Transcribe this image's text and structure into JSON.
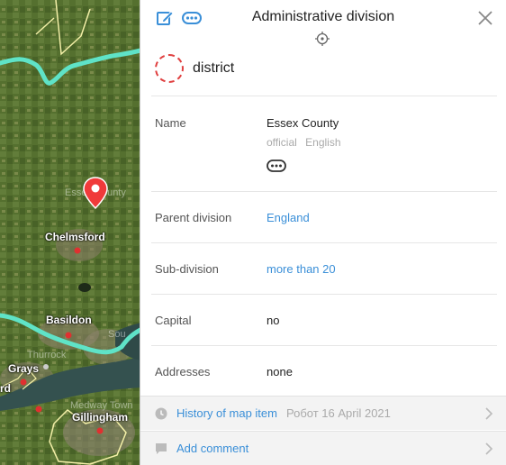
{
  "map": {
    "labels": {
      "chelmsford": "Chelmsford",
      "basildon": "Basildon",
      "grays": "Grays",
      "rd": "rd",
      "gillingham": "Gillingham",
      "essex_faint": "Essex County",
      "thurrock": "Thurrock",
      "medway": "Medway Town",
      "south": "Sou"
    },
    "colors": {
      "boundary": "#5fe3c7",
      "pin": "#f03a3a"
    }
  },
  "panel": {
    "title": "Administrative division",
    "category": "district",
    "rows": {
      "name": {
        "label": "Name",
        "value": "Essex County",
        "status": "official",
        "language": "English"
      },
      "parent": {
        "label": "Parent division",
        "value": "England"
      },
      "subdivision": {
        "label": "Sub-division",
        "value": "more than 20"
      },
      "capital": {
        "label": "Capital",
        "value": "no"
      },
      "addresses": {
        "label": "Addresses",
        "value": "none"
      }
    },
    "history": {
      "label": "History of map item",
      "meta": "Робот 16 April 2021"
    },
    "comment": {
      "label": "Add comment"
    },
    "icons": [
      "edit-icon",
      "more-icon",
      "close-icon",
      "target-icon",
      "clock-icon",
      "comment-icon",
      "chevron-right-icon"
    ]
  }
}
